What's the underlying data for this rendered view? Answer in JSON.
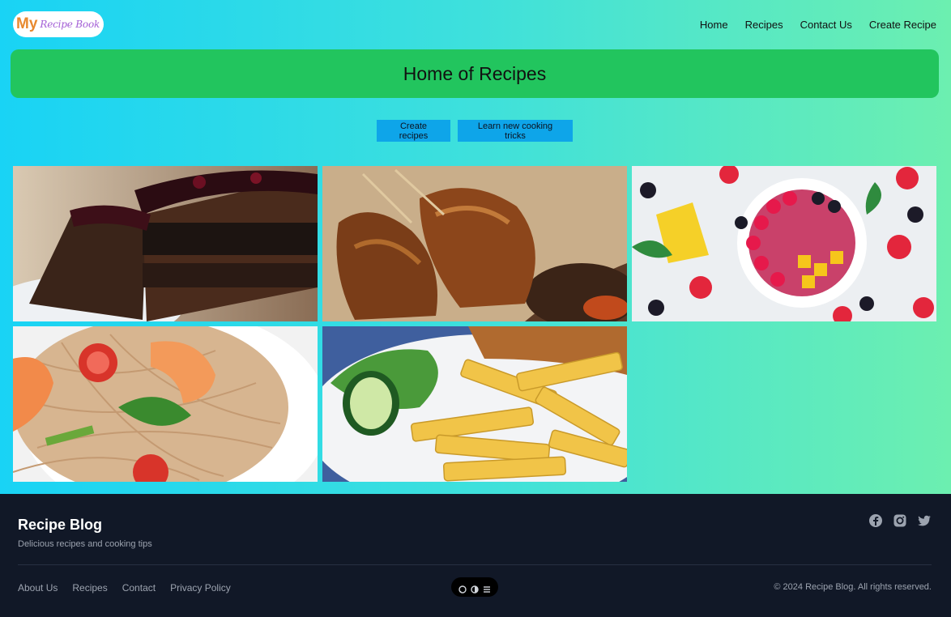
{
  "header": {
    "logo_prefix": "My",
    "logo_script": "Recipe Book",
    "nav": [
      {
        "label": "Home"
      },
      {
        "label": "Recipes"
      },
      {
        "label": "Contact Us"
      },
      {
        "label": "Create Recipe"
      }
    ]
  },
  "hero": {
    "title": "Home of Recipes"
  },
  "actions": {
    "create_label": "Create recipes",
    "learn_label": "Learn new cooking tricks"
  },
  "gallery": [
    {
      "icon": "chocolate-cake-image"
    },
    {
      "icon": "grilled-chicken-image"
    },
    {
      "icon": "fruit-bowl-image"
    },
    {
      "icon": "shrimp-pasta-image"
    },
    {
      "icon": "fries-salad-image"
    }
  ],
  "footer": {
    "brand": "Recipe Blog",
    "tagline": "Delicious recipes and cooking tips",
    "links": [
      {
        "label": "About Us"
      },
      {
        "label": "Recipes"
      },
      {
        "label": "Contact"
      },
      {
        "label": "Privacy Policy"
      }
    ],
    "copyright": "© 2024 Recipe Blog. All rights reserved.",
    "social": [
      "facebook-icon",
      "instagram-icon",
      "twitter-icon"
    ]
  },
  "colors": {
    "hero": "#22c55e",
    "button": "#0ea5e9",
    "footer": "#111827",
    "gradient_start": "#19d3f5",
    "gradient_end": "#6cefb0"
  }
}
